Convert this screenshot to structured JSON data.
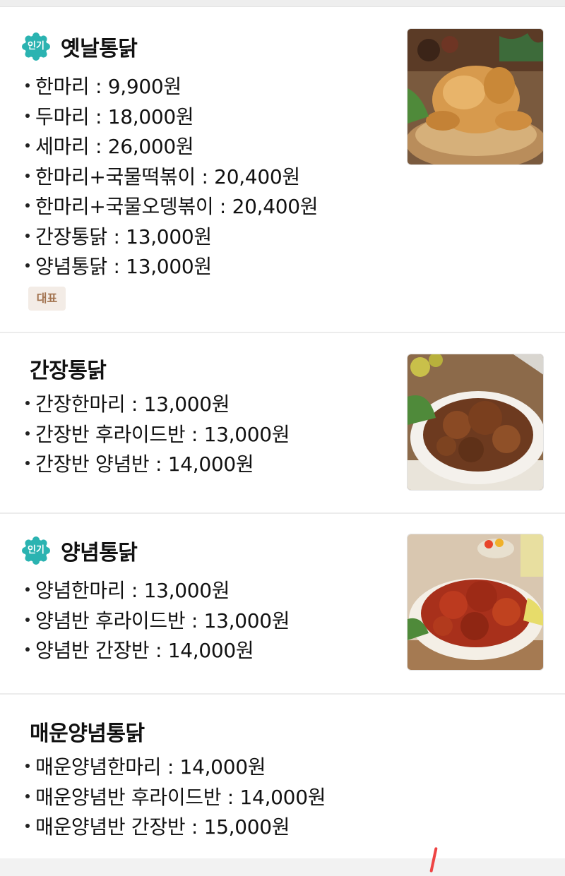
{
  "menu": {
    "items": [
      {
        "title": "옛날통닭",
        "badge": "인기",
        "tag": "대표",
        "image_icon": "whole-fried-chicken-photo",
        "options": [
          "한마리 : 9,900원",
          "두마리 : 18,000원",
          "세마리 : 26,000원",
          "한마리+국물떡볶이 : 20,400원",
          "한마리+국물오뎅볶이 : 20,400원",
          "간장통닭 : 13,000원",
          "양념통닭 : 13,000원"
        ]
      },
      {
        "title": "간장통닭",
        "image_icon": "soy-sauce-chicken-photo",
        "options": [
          "간장한마리 : 13,000원",
          "간장반 후라이드반 : 13,000원",
          "간장반 양념반 : 14,000원"
        ]
      },
      {
        "title": "양념통닭",
        "badge": "인기",
        "image_icon": "seasoned-chicken-photo",
        "options": [
          "양념한마리 : 13,000원",
          "양념반 후라이드반 : 13,000원",
          "양념반 간장반 : 14,000원"
        ]
      },
      {
        "title": "매운양념통닭",
        "options": [
          "매운양념한마리 : 14,000원",
          "매운양념반 후라이드반 : 14,000원",
          "매운양념반 간장반 : 15,000원"
        ]
      }
    ]
  },
  "colors": {
    "badge_teal": "#2bb3b1",
    "tag_text": "#a2734f",
    "tag_bg": "#f3ece6"
  }
}
